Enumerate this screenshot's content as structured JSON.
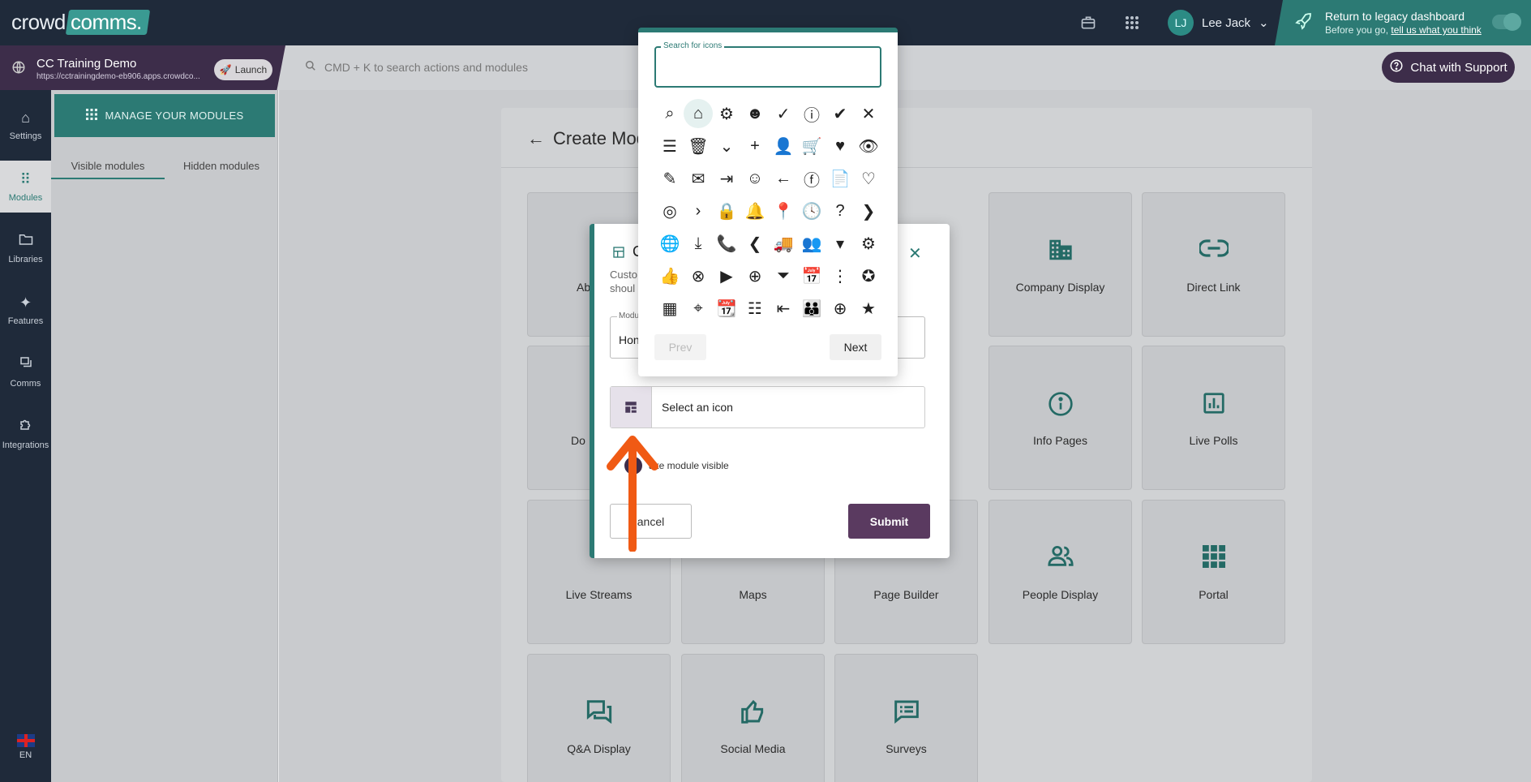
{
  "brand": {
    "name_left": "crowd",
    "name_right": "comms",
    "name_dot": "."
  },
  "topbar": {
    "user_initials": "LJ",
    "user_name": "Lee Jack",
    "legacy_title": "Return to legacy dashboard",
    "legacy_sub_prefix": "Before you go, ",
    "legacy_sub_link": "tell us what you think"
  },
  "event": {
    "name": "CC Training Demo",
    "url": "https://cctrainingdemo-eb906.apps.crowdco...",
    "launch_label": "Launch"
  },
  "search": {
    "placeholder": "CMD + K to search actions and modules"
  },
  "support": {
    "label": "Chat with Support"
  },
  "nav": [
    {
      "label": "Settings"
    },
    {
      "label": "Modules"
    },
    {
      "label": "Libraries"
    },
    {
      "label": "Features"
    },
    {
      "label": "Comms"
    },
    {
      "label": "Integrations"
    }
  ],
  "language": "EN",
  "modules_panel": {
    "manage_label": "MANAGE YOUR MODULES",
    "tab_visible": "Visible modules",
    "tab_hidden": "Hidden modules"
  },
  "page": {
    "title": "Create Mod"
  },
  "module_cards": [
    {
      "label": "Ab",
      "icon": ""
    },
    {
      "label": "Company Display",
      "icon": "building-icon"
    },
    {
      "label": "Direct Link",
      "icon": "link-icon"
    },
    {
      "label": "Do",
      "icon": ""
    },
    {
      "label": "Info Pages",
      "icon": "info-icon"
    },
    {
      "label": "Live Polls",
      "icon": "poll-icon"
    },
    {
      "label": "Live Streams",
      "icon": "stream-icon"
    },
    {
      "label": "Maps",
      "icon": "map-icon"
    },
    {
      "label": "Page Builder",
      "icon": "builder-icon"
    },
    {
      "label": "People Display",
      "icon": "people-icon"
    },
    {
      "label": "Portal",
      "icon": "grid-icon"
    },
    {
      "label": "Q&A Display",
      "icon": "forum-icon"
    },
    {
      "label": "Social Media",
      "icon": "thumb-up-icon"
    },
    {
      "label": "Surveys",
      "icon": "survey-icon"
    }
  ],
  "dialog": {
    "title": "C",
    "subtitle_line1": "Custo",
    "subtitle_line2": "shoul",
    "subtitle_tail": "e",
    "name_label": "Modu",
    "name_value": "Hon",
    "icon_select_label": "Select an icon",
    "visible_label": "ake module visible",
    "cancel_label": "ancel",
    "submit_label": "Submit"
  },
  "picker": {
    "search_label": "Search for icons",
    "search_value": "",
    "prev_label": "Prev",
    "next_label": "Next",
    "icons": [
      "search",
      "home",
      "gear",
      "account-circle",
      "check",
      "info",
      "check-circle",
      "close",
      "menu",
      "trash",
      "chevron-down",
      "plus",
      "person",
      "cart",
      "heart",
      "eye",
      "pencil",
      "mail",
      "logout",
      "face",
      "arrow-left",
      "facebook",
      "document",
      "heart-outline",
      "fingerprint",
      "chevron-right-small",
      "lock",
      "bell",
      "place",
      "clock",
      "help",
      "chevron-right",
      "globe",
      "download",
      "phone",
      "chevron-left",
      "truck",
      "groups",
      "caret-down",
      "manage-accounts",
      "thumb-up",
      "cancel",
      "play",
      "add-circle-outline",
      "filter",
      "event",
      "more-vert",
      "verified",
      "dashboard",
      "place-2",
      "calendar",
      "list",
      "login",
      "people",
      "add-circle",
      "star"
    ],
    "selected_index": 1
  }
}
